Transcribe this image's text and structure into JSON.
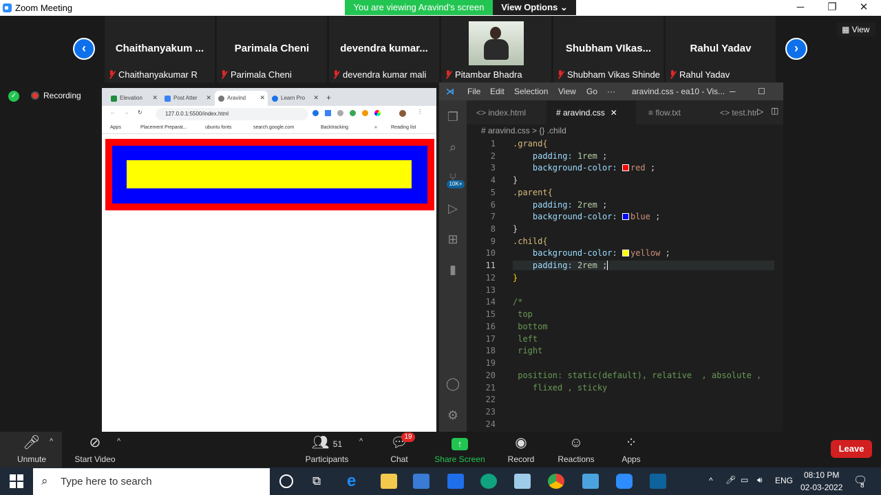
{
  "window": {
    "title": "Zoom Meeting",
    "viewing_banner": "You are viewing Aravind's screen",
    "view_options": "View Options ⌄"
  },
  "view_button": "View",
  "participants_strip": [
    {
      "name": "Chaithanyakum ...",
      "label": "Chaithanyakumar R"
    },
    {
      "name": "Parimala Cheni",
      "label": "Parimala Cheni"
    },
    {
      "name": "devendra  kumar...",
      "label": "devendra kumar mali"
    },
    {
      "name": "",
      "label": "Pitambar Bhadra"
    },
    {
      "name": "Shubham  VIkas...",
      "label": "Shubham Vikas Shinde"
    },
    {
      "name": "Rahul Yadav",
      "label": "Rahul Yadav"
    }
  ],
  "recording": "Recording",
  "browser": {
    "tabs": [
      "Elevation",
      "Post Atter",
      "Aravind",
      "Learn Pro"
    ],
    "url": "127.0.0.1:5500/index.html",
    "bookmarks": [
      "Apps",
      "Placement Preparat...",
      "ubuntu fonts",
      "search.google.com",
      "Backtracking",
      "»",
      "Reading list"
    ]
  },
  "vscode": {
    "menu": [
      "File",
      "Edit",
      "Selection",
      "View",
      "Go",
      "···"
    ],
    "title": "aravind.css - ea10 - Vis...",
    "tabs": [
      "<> index.html",
      "# aravind.css",
      "≡ flow.txt",
      "<> test.htr"
    ],
    "breadcrumb": "# aravind.css > {} .child",
    "badge": "10K+",
    "line_numbers": [
      "1",
      "2",
      "3",
      "4",
      "5",
      "6",
      "7",
      "8",
      "9",
      "10",
      "11",
      "12",
      "13",
      "14",
      "15",
      "16",
      "17",
      "18",
      "19",
      "20",
      "21",
      "22",
      "23",
      "24"
    ]
  },
  "code_tokens": {
    "grand_sel": ".grand{",
    "padding": "padding:",
    "one_rem": "1rem",
    "bg": "background-color:",
    "red": "red",
    "close": "}",
    "parent_sel": ".parent{",
    "two_rem": "2rem",
    "blue": "blue",
    "child_sel": ".child{",
    "yellow": "yellow",
    "semi": ";",
    "c_open": "/*",
    "top": "top",
    "bottom": "bottom",
    "left": "left",
    "right": "right",
    "position_line": "position: static(default), relative  , absolute ,",
    "position_cont": "flixed , sticky"
  },
  "colors": {
    "red": "#ff0000",
    "blue": "#0000ff",
    "yellow": "#ffff00",
    "leave": "#d21f1f",
    "zoom_blue": "#0E71EB"
  },
  "toolbar": {
    "unmute": "Unmute",
    "start_video": "Start Video",
    "participants": "Participants",
    "participant_count": "51",
    "chat": "Chat",
    "chat_badge": "19",
    "share_screen": "Share Screen",
    "record": "Record",
    "reactions": "Reactions",
    "apps": "Apps",
    "leave": "Leave"
  },
  "taskbar": {
    "search_placeholder": "Type here to search",
    "lang": "ENG",
    "time": "08:10 PM",
    "date": "02-03-2022",
    "notif_count": "8"
  }
}
